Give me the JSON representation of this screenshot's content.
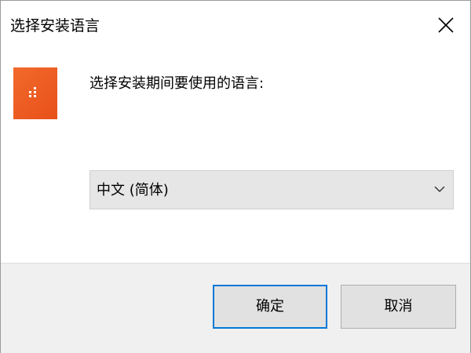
{
  "window": {
    "title": "选择安装语言",
    "close_icon": "close-icon"
  },
  "app_icon": {
    "icon": "installer-app-icon",
    "color": "#ec5a1f"
  },
  "prompt": {
    "text": "选择安装期间要使用的语言:"
  },
  "language_select": {
    "selected": "中文 (简体)",
    "icon": "chevron-down-icon"
  },
  "buttons": {
    "ok_label": "确定",
    "cancel_label": "取消"
  },
  "colors": {
    "accent": "#0078d7",
    "footer_bg": "#f0f0f0",
    "select_bg": "#e6e6e6"
  }
}
